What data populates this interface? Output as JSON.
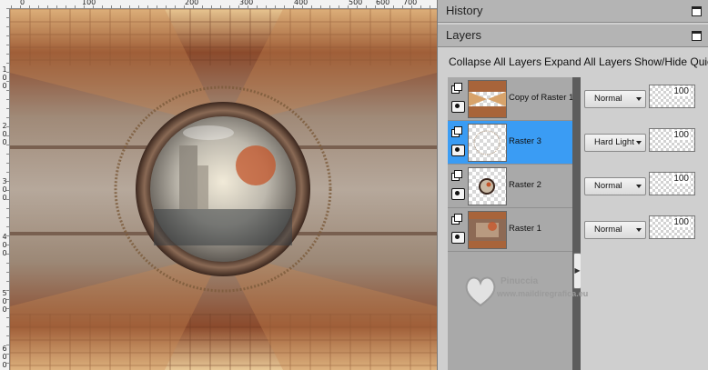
{
  "ruler": {
    "top_labels": [
      "0",
      "100",
      "200",
      "300",
      "400",
      "500",
      "600",
      "700"
    ],
    "left_labels": [
      "1",
      "2",
      "3",
      "4",
      "5",
      "6"
    ],
    "left_zeros": "0"
  },
  "history": {
    "title": "History"
  },
  "layers": {
    "title": "Layers",
    "toolbar": {
      "collapse_all": "Collapse All Layers",
      "expand_all": "Expand All Layers",
      "show_hide": "Show/Hide Quic"
    },
    "items": [
      {
        "name": "Copy of Raster 1",
        "blend_mode": "Normal",
        "opacity": "100",
        "selected": false
      },
      {
        "name": "Raster 3",
        "blend_mode": "Hard Light",
        "opacity": "100",
        "selected": true
      },
      {
        "name": "Raster 2",
        "blend_mode": "Normal",
        "opacity": "100",
        "selected": false
      },
      {
        "name": "Raster 1",
        "blend_mode": "Normal",
        "opacity": "100",
        "selected": false
      }
    ]
  },
  "watermark": {
    "line1": "Pinuccia",
    "line2": "www.maildiregrafica.eu"
  },
  "colors": {
    "selected": "#3a9cf4",
    "panel_bg": "#cfcfcf",
    "header_bg": "#b4b4b4"
  }
}
